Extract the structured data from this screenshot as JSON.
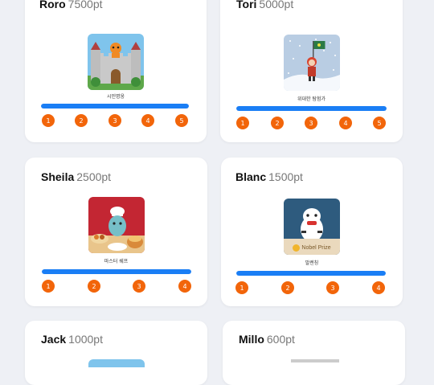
{
  "cards": [
    {
      "name": "Roro",
      "points": "7500pt",
      "badge_label": "시민명웅",
      "progress": 1.0,
      "steps": [
        "1",
        "2",
        "3",
        "4",
        "5"
      ]
    },
    {
      "name": "Tori",
      "points": "5000pt",
      "badge_label": "위대한 탐험가",
      "progress": 1.0,
      "steps": [
        "1",
        "2",
        "3",
        "4",
        "5"
      ]
    },
    {
      "name": "Sheila",
      "points": "2500pt",
      "badge_label": "마스터 쉐프",
      "progress": 1.0,
      "steps": [
        "1",
        "2",
        "3",
        "4"
      ]
    },
    {
      "name": "Blanc",
      "points": "1500pt",
      "badge_label": "발렌칭",
      "badge_text": "Nobel Prize",
      "progress": 1.0,
      "steps": [
        "1",
        "2",
        "3",
        "4"
      ]
    },
    {
      "name": "Jack",
      "points": "1000pt"
    },
    {
      "name": "Millo",
      "points": "600pt"
    }
  ],
  "colors": {
    "progress": "#1a7ef5",
    "step": "#f2650a",
    "background": "#eef0f5"
  }
}
